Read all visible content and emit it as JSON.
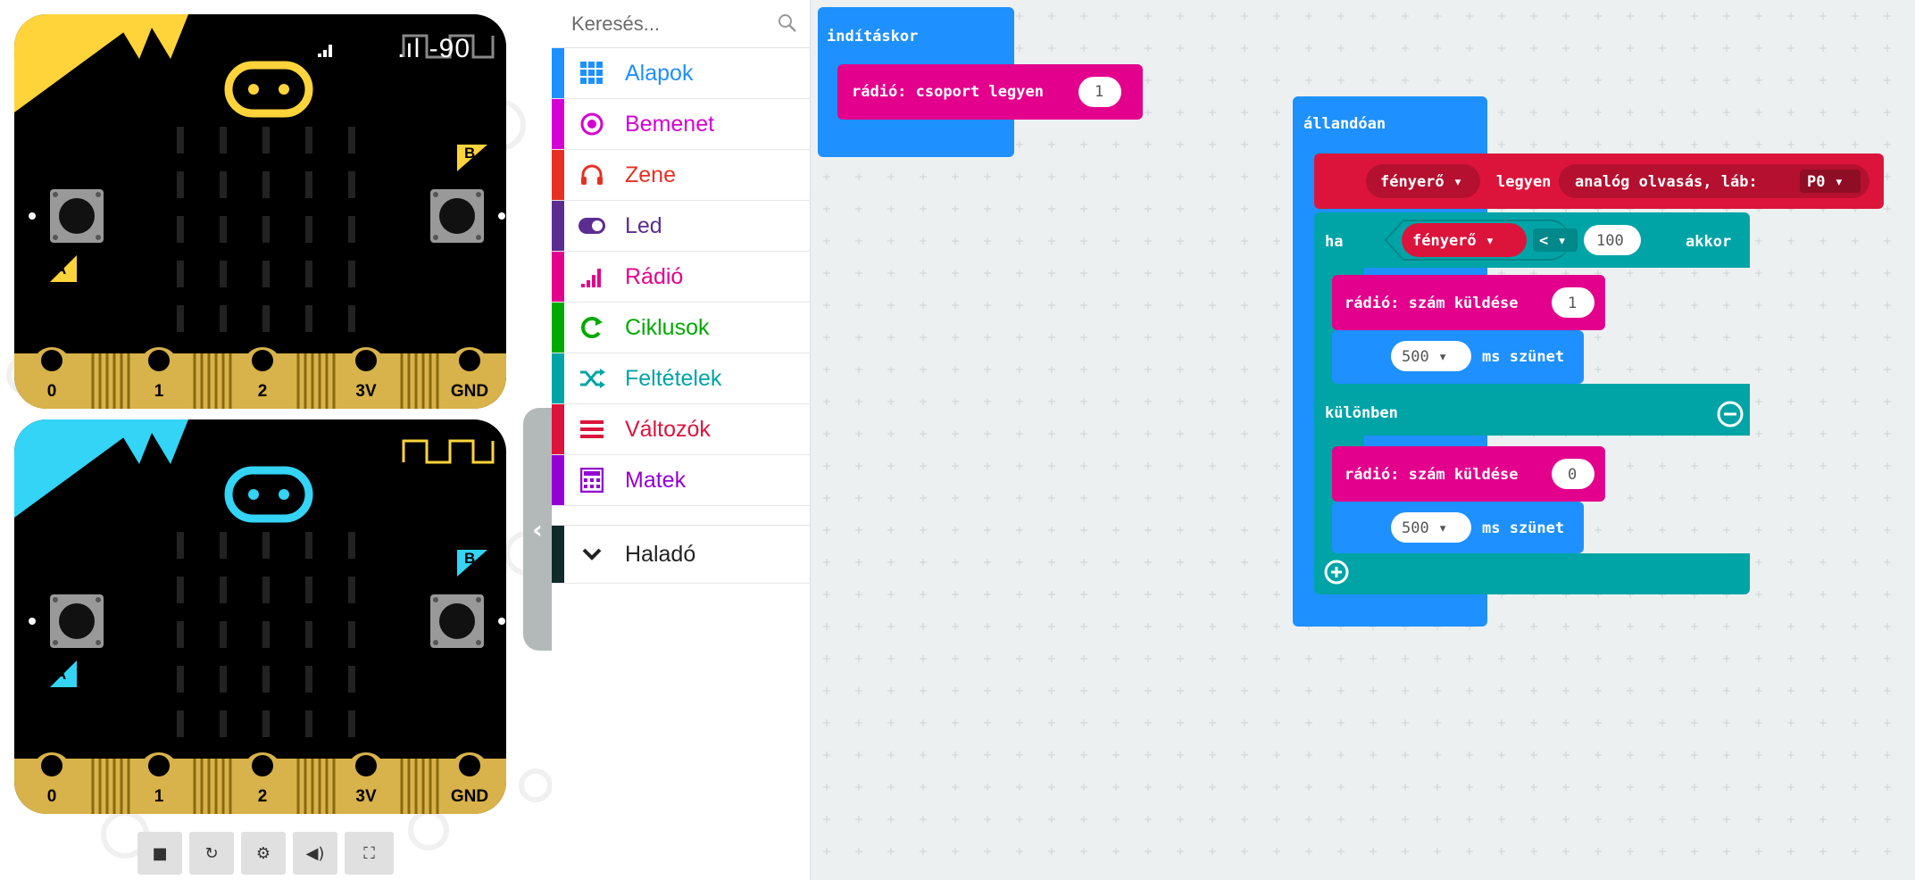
{
  "simulator": {
    "board1": {
      "theme": "#ffd43b",
      "signal": ".ıl -90",
      "button_a": "A",
      "button_b": "B",
      "pins": [
        "0",
        "1",
        "2",
        "3V",
        "GND"
      ]
    },
    "board2": {
      "theme": "#33d4f5",
      "button_a": "A",
      "button_b": "B",
      "pins": [
        "0",
        "1",
        "2",
        "3V",
        "GND"
      ]
    },
    "toolbar": {
      "stop": "■",
      "restart": "↻",
      "debug": "⚙",
      "mute": "◀)",
      "fullscreen": "⛶"
    },
    "collapse_icon": "chevron-left-icon"
  },
  "toolbox": {
    "search_placeholder": "Keresés...",
    "categories": [
      {
        "label": "Alapok",
        "color": "#1e90ff",
        "icon": "grid-icon"
      },
      {
        "label": "Bemenet",
        "color": "#d400d4",
        "icon": "target-icon"
      },
      {
        "label": "Zene",
        "color": "#e63022",
        "icon": "headphones-icon"
      },
      {
        "label": "Led",
        "color": "#5c2d91",
        "icon": "toggle-icon"
      },
      {
        "label": "Rádió",
        "color": "#e3008c",
        "icon": "signal-icon"
      },
      {
        "label": "Ciklusok",
        "color": "#00aa00",
        "icon": "loop-icon"
      },
      {
        "label": "Feltételek",
        "color": "#00a4a6",
        "icon": "shuffle-icon"
      },
      {
        "label": "Változók",
        "color": "#dc143c",
        "icon": "list-icon"
      },
      {
        "label": "Matek",
        "color": "#9400d3",
        "icon": "calculator-icon"
      }
    ],
    "advanced": {
      "label": "Haladó",
      "color": "#3c3c3c",
      "icon": "chevron-down-icon"
    }
  },
  "workspace": {
    "on_start": {
      "title": "indításkor",
      "radio_group": {
        "label": "rádió: csoport legyen",
        "value": "1"
      }
    },
    "forever": {
      "title": "állandóan",
      "set": {
        "variable": "fényerő ▾",
        "label": "legyen",
        "reader": "analóg olvasás, láb:",
        "pin": "P0 ▾"
      },
      "if": {
        "label": "ha",
        "condition_var": "fényerő ▾",
        "operator": "< ▾",
        "compare_value": "100",
        "then_label": "akkor",
        "then": {
          "send_label": "rádió: szám küldése",
          "send_value": "1",
          "pause_value": "500 ▾",
          "pause_label": "ms szünet"
        },
        "else_label": "különben",
        "else": {
          "send_label": "rádió: szám küldése",
          "send_value": "0",
          "pause_value": "500 ▾",
          "pause_label": "ms szünet"
        }
      }
    }
  }
}
